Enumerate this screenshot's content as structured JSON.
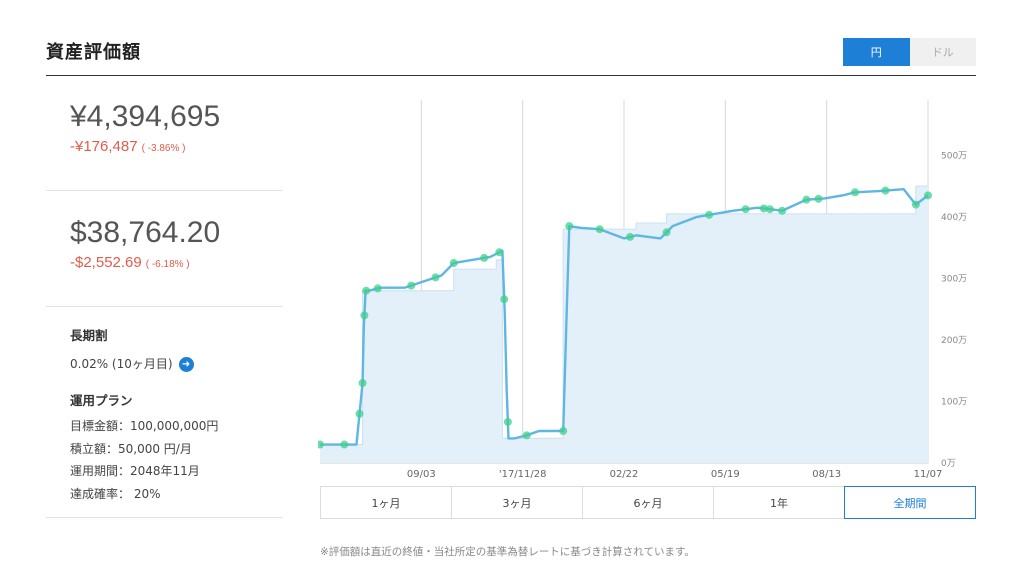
{
  "header": {
    "title": "資産評価額",
    "currency_options": [
      {
        "label": "円",
        "active": true
      },
      {
        "label": "ドル",
        "active": false
      }
    ]
  },
  "yen": {
    "value": "¥4,394,695",
    "change": "-¥176,487",
    "pct": "( -3.86% )"
  },
  "usd": {
    "value": "$38,764.20",
    "change": "-$2,552.69",
    "pct": "( -6.18% )"
  },
  "long_term": {
    "title": "長期割",
    "value": "0.02% (10ヶ月目)"
  },
  "plan": {
    "title": "運用プラン",
    "lines": [
      "目標金額：100,000,000円",
      "積立額：50,000 円/月",
      "運用期間：2048年11月",
      "達成確率： 20%"
    ]
  },
  "periods": [
    {
      "label": "1ヶ月",
      "active": false
    },
    {
      "label": "3ヶ月",
      "active": false
    },
    {
      "label": "6ヶ月",
      "active": false
    },
    {
      "label": "1年",
      "active": false
    },
    {
      "label": "全期間",
      "active": true
    }
  ],
  "footnote": "※評価額は直近の終値・当社所定の基準為替レートに基づき計算されています。",
  "colors": {
    "accent": "#1e7fd6",
    "negative": "#e15b4b",
    "line": "#5fb6e3",
    "fill": "#e3f0f9",
    "marker": "#3ecf8e"
  },
  "chart_data": {
    "type": "line",
    "x_ticks": [
      "09/03",
      "'17/11/28",
      "02/22",
      "05/19",
      "08/13",
      "11/07"
    ],
    "y_ticks": [
      "0万",
      "100万",
      "200万",
      "300万",
      "400万",
      "500万"
    ],
    "ylim": [
      0,
      5900000
    ],
    "grid": true,
    "series": [
      {
        "name": "",
        "x": [
          0,
          3,
          6,
          7,
          7.2,
          7.5,
          8,
          10,
          14,
          17,
          20,
          22,
          25,
          28,
          30,
          30.4,
          30.7,
          31,
          32,
          34,
          36,
          38,
          40,
          40.5,
          41,
          43,
          46,
          50,
          52,
          56,
          58,
          62,
          65,
          68,
          72,
          76,
          80,
          83,
          86,
          88,
          92,
          96,
          98,
          100
        ],
        "y": [
          300000,
          300000,
          300000,
          1300000,
          2200000,
          2800000,
          2800000,
          2850000,
          2850000,
          2950000,
          3050000,
          3250000,
          3300000,
          3350000,
          3450000,
          2400000,
          1200000,
          400000,
          400000,
          450000,
          520000,
          520000,
          520000,
          2200000,
          3850000,
          3820000,
          3800000,
          3650000,
          3700000,
          3650000,
          3850000,
          4000000,
          4050000,
          4100000,
          4150000,
          4100000,
          4280000,
          4300000,
          4350000,
          4400000,
          4420000,
          4450000,
          4200000,
          4350000
        ]
      },
      {
        "name": "",
        "x": [
          0,
          7,
          7,
          22,
          22,
          29,
          29,
          30,
          30,
          40,
          40,
          52,
          52,
          57,
          57,
          98,
          98,
          100
        ],
        "y": [
          300000,
          300000,
          2800000,
          2800000,
          3150000,
          3150000,
          3300000,
          3300000,
          400000,
          400000,
          3800000,
          3800000,
          3900000,
          3900000,
          4050000,
          4050000,
          4500000,
          4500000
        ]
      }
    ],
    "markers_x": [
      0,
      4,
      6.5,
      7,
      7.3,
      7.6,
      9.5,
      15,
      19,
      22,
      27,
      29.5,
      30.3,
      30.9,
      34,
      40,
      41,
      46,
      51,
      57,
      64,
      70,
      73,
      74,
      76,
      80,
      82,
      88,
      93,
      98,
      100
    ]
  }
}
